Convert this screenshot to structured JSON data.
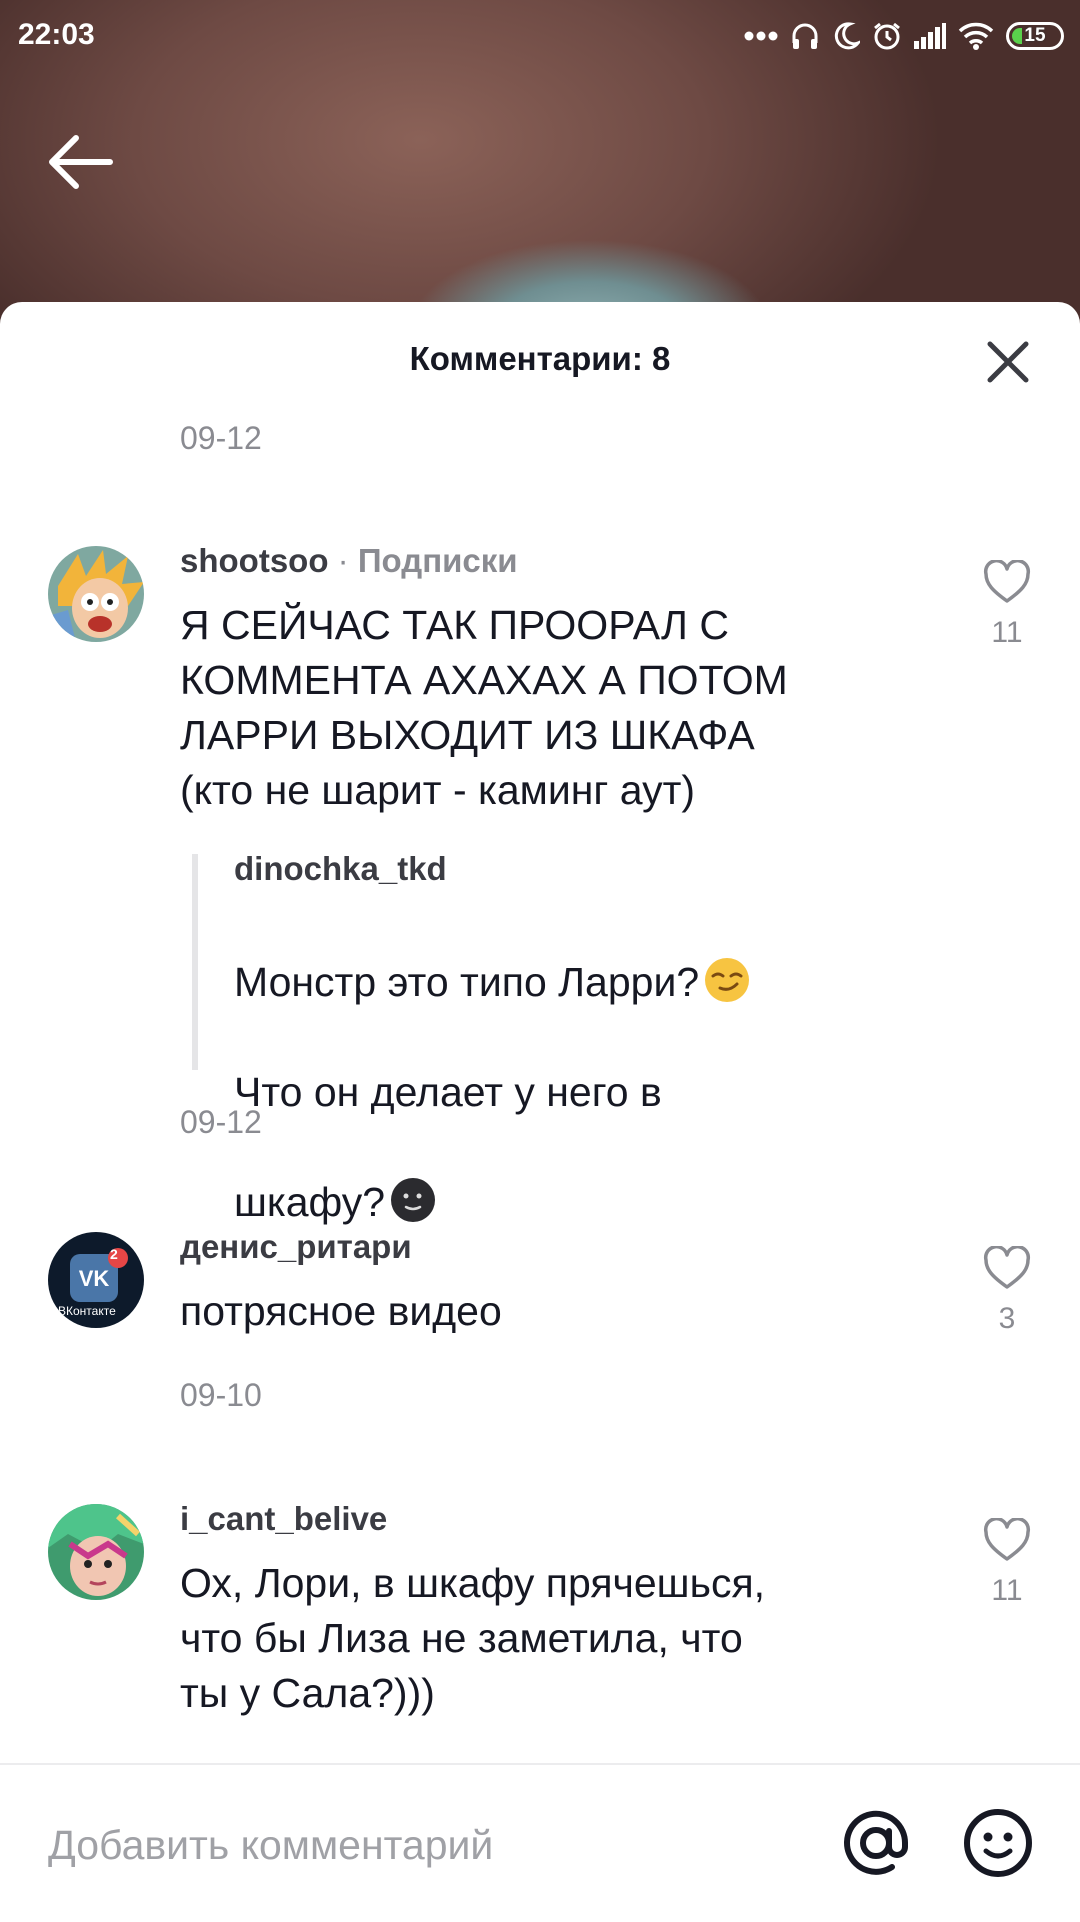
{
  "status_bar": {
    "time": "22:03",
    "battery": "15",
    "icons": [
      "more-dots-icon",
      "headphones-icon",
      "moon-icon",
      "alarm-icon",
      "signal-icon",
      "wifi-icon",
      "battery-icon"
    ]
  },
  "sheet": {
    "title": "Комментарии: 8"
  },
  "comments": [
    {
      "username": "shootsoo",
      "separator": "·",
      "tag": "Подписки",
      "text": "Я СЕЙЧАС ТАК ПРООРАЛ С\nКОММЕНТА АХАХАХ А ПОТОМ\nЛАРРИ ВЫХОДИТ ИЗ ШКАФА\n(кто не шарит - каминг аут)",
      "likes": "11",
      "reply": {
        "username": "dinochka_tkd",
        "text_line1": "Монстр это типо Ларри?",
        "text_line2": "Что он делает у него в",
        "text_line3": "шкафу?"
      },
      "date": "09-12"
    },
    {
      "username": "денис_ритари",
      "avatar_label": "ВКонтакте",
      "avatar_badge": "2",
      "text": "потрясное видео",
      "likes": "3",
      "date": "09-10"
    },
    {
      "username": "i_cant_belive",
      "text": "Ох, Лори, в шкафу прячешься,\nчто бы Лиза не заметила, что\nты у Сала?)))",
      "likes": "11"
    }
  ],
  "top_date": "09-12",
  "input": {
    "placeholder": "Добавить комментарий",
    "value": ""
  },
  "colors": {
    "text_primary": "#161823",
    "text_secondary": "#8a8b91",
    "sheet_bg": "#ffffff"
  }
}
